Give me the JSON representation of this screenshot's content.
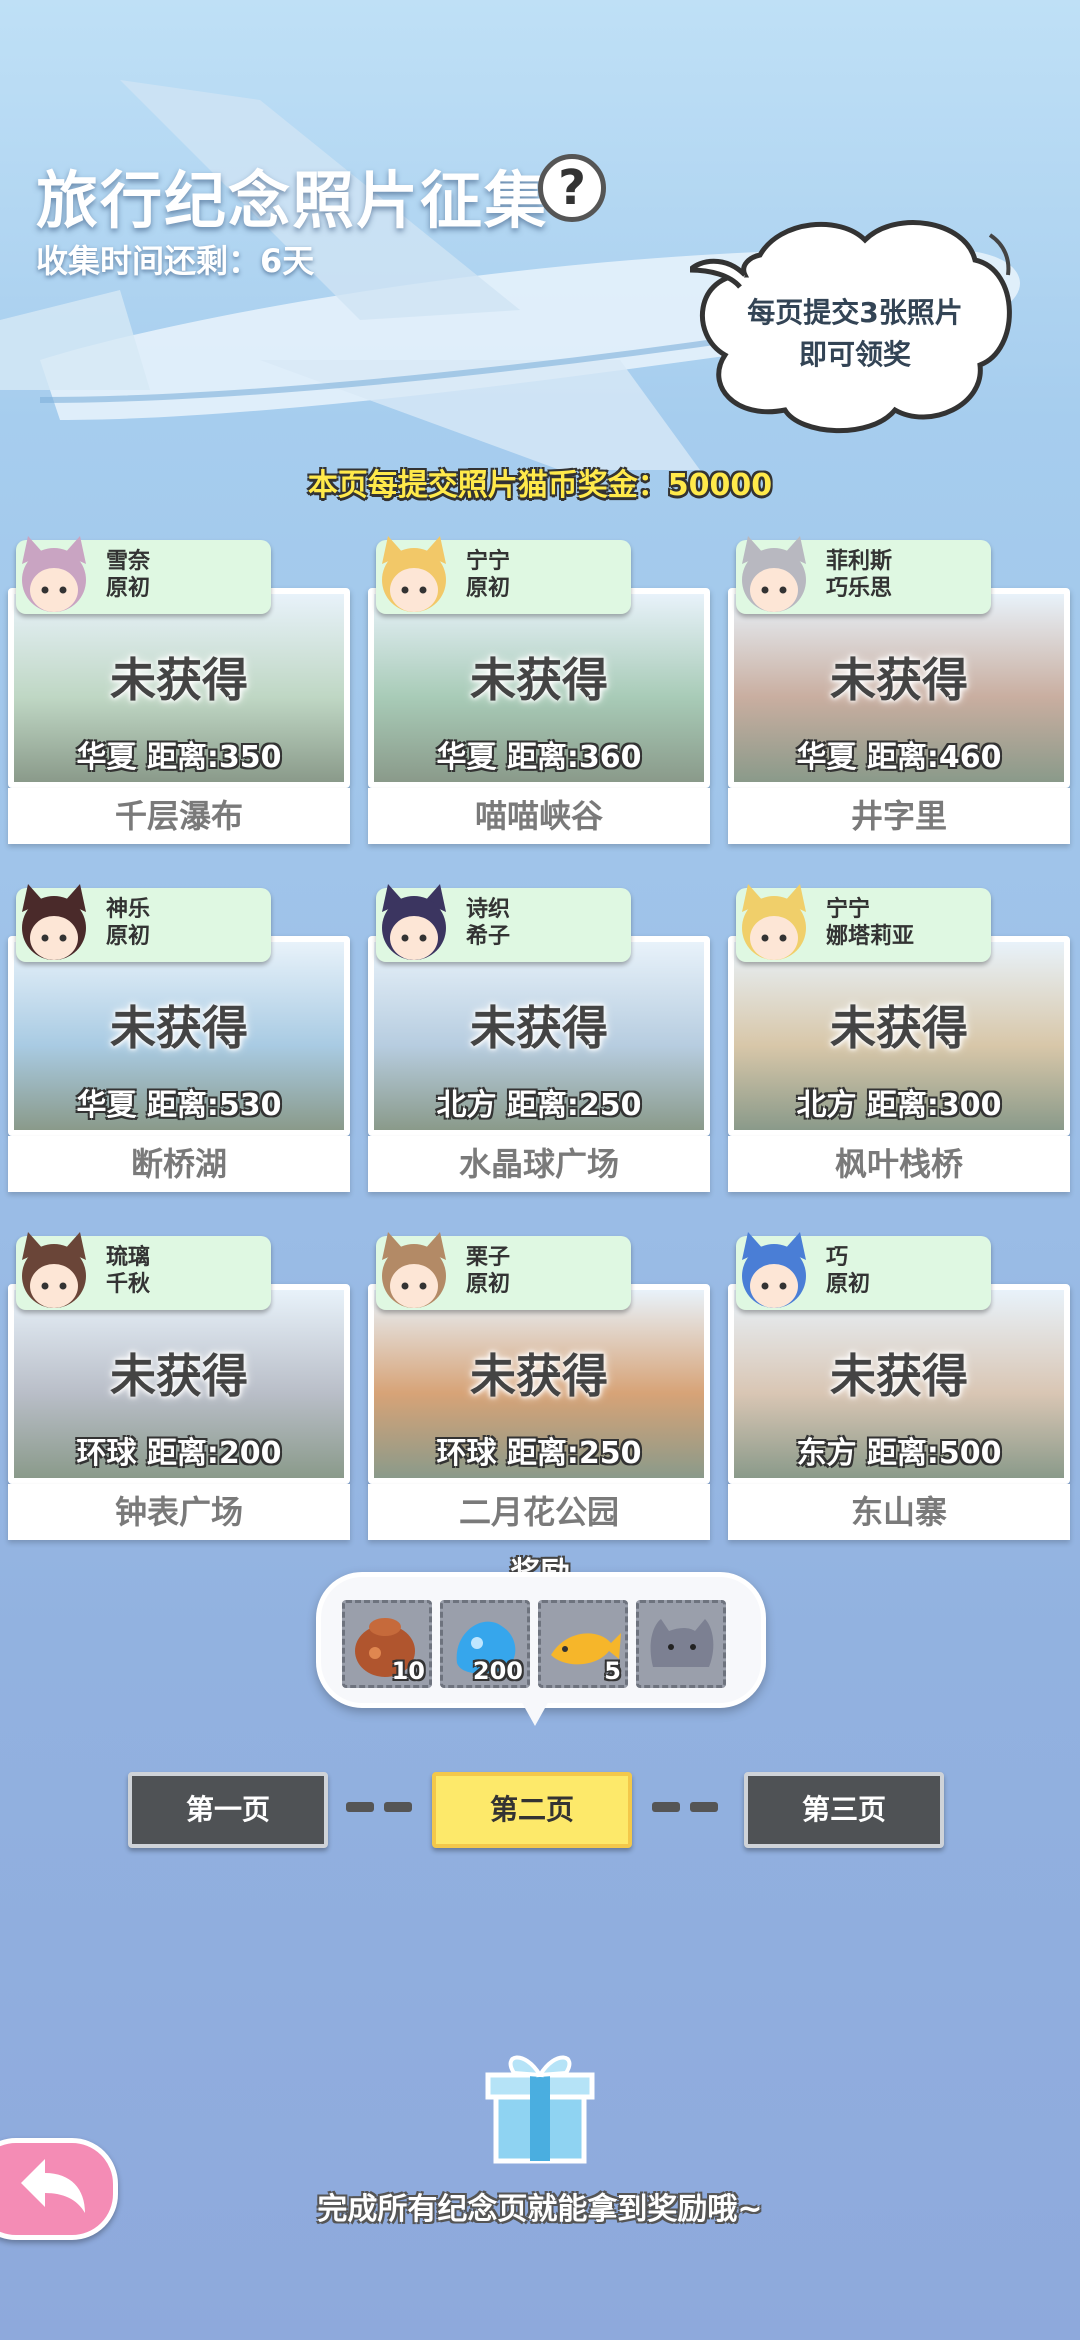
{
  "header": {
    "title": "旅行纪念照片征集",
    "help_label": "?",
    "timer": "收集时间还剩：6天",
    "bubble": [
      "每页提交3张照片",
      "即可领奖"
    ]
  },
  "bonus_text": "本页每提交照片猫币奖金：50000",
  "cards": [
    {
      "chars": [
        "雪奈",
        "原初"
      ],
      "status": "未获得",
      "info": "华夏  距离:350",
      "name": "千层瀑布",
      "theme": "#bfd7c4",
      "hair": "#c9a4c2"
    },
    {
      "chars": [
        "宁宁",
        "原初"
      ],
      "status": "未获得",
      "info": "华夏  距离:360",
      "name": "喵喵峡谷",
      "theme": "#a8cbb7",
      "hair": "#f2c868"
    },
    {
      "chars": [
        "菲利斯",
        "巧乐思"
      ],
      "status": "未获得",
      "info": "华夏  距离:460",
      "name": "井字里",
      "theme": "#c9aea0",
      "hair": "#b8b8c0"
    },
    {
      "chars": [
        "神乐",
        "原初"
      ],
      "status": "未获得",
      "info": "华夏  距离:530",
      "name": "断桥湖",
      "theme": "#a9cbe3",
      "hair": "#4a2a2a"
    },
    {
      "chars": [
        "诗织",
        "希子"
      ],
      "status": "未获得",
      "info": "北方  距离:250",
      "name": "水晶球广场",
      "theme": "#b7cde0",
      "hair": "#3b3560"
    },
    {
      "chars": [
        "宁宁",
        "娜塔莉亚"
      ],
      "status": "未获得",
      "info": "北方  距离:300",
      "name": "枫叶栈桥",
      "theme": "#d8c7a9",
      "hair": "#f0cf6a"
    },
    {
      "chars": [
        "琉璃",
        "千秋"
      ],
      "status": "未获得",
      "info": "环球  距离:200",
      "name": "钟表广场",
      "theme": "#b9bec8",
      "hair": "#6a4538"
    },
    {
      "chars": [
        "栗子",
        "原初"
      ],
      "status": "未获得",
      "info": "环球  距离:250",
      "name": "二月花公园",
      "theme": "#d7a377",
      "hair": "#b38a66"
    },
    {
      "chars": [
        "巧",
        "原初"
      ],
      "status": "未获得",
      "info": "东方  距离:500",
      "name": "东山寨",
      "theme": "#d9c6b4",
      "hair": "#4a7ed6"
    }
  ],
  "reward": {
    "label": "奖励",
    "items": [
      {
        "icon": "brown-food-bag-icon",
        "count": "10"
      },
      {
        "icon": "blue-slime-icon",
        "count": "200"
      },
      {
        "icon": "fish-icon",
        "count": "5"
      },
      {
        "icon": "cat-plush-icon",
        "count": ""
      }
    ]
  },
  "pages": {
    "first": "第一页",
    "second": "第二页",
    "third": "第三页",
    "active": "second"
  },
  "footer": "完成所有纪念页就能拿到奖励哦~",
  "colors": {
    "accent_yellow": "#fde96a",
    "tag_green": "#dff8e2",
    "back_pink": "#f48cb5",
    "bonus_yellow": "#ffe94a"
  }
}
